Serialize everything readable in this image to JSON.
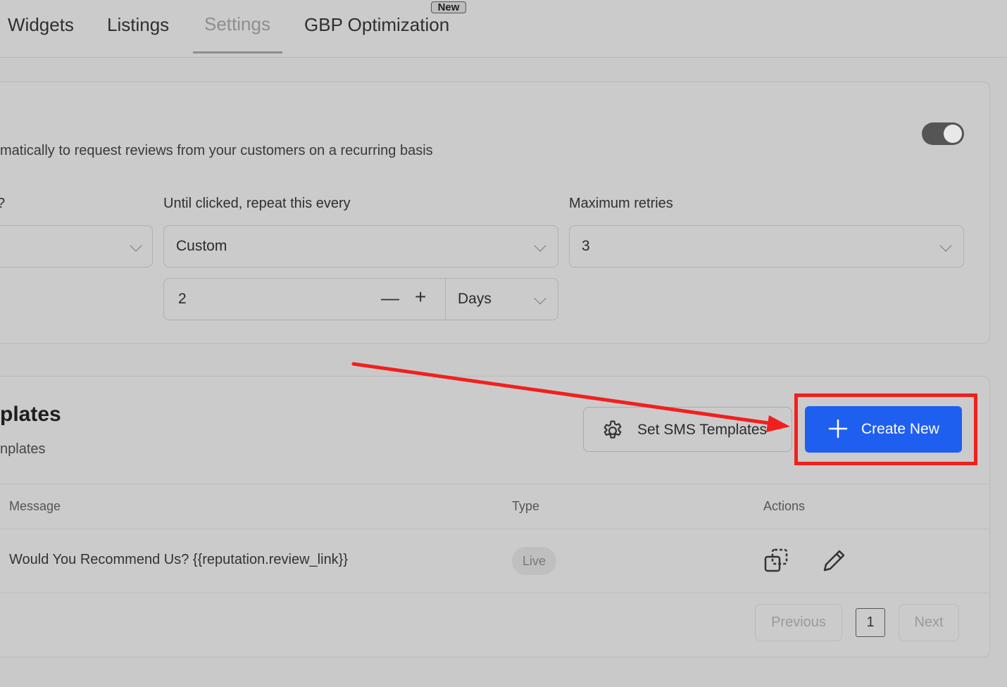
{
  "nav": {
    "tabs": [
      {
        "label": "Widgets"
      },
      {
        "label": "Listings"
      },
      {
        "label": "Settings"
      },
      {
        "label": "GBP Optimization"
      }
    ],
    "new_badge": "New"
  },
  "automation": {
    "description": "matically to request reviews from your customers on a recurring basis",
    "toggle_on": true,
    "first_label": "?",
    "repeat_label": "Until clicked, repeat this every",
    "repeat_value": "Custom",
    "max_retries_label": "Maximum retries",
    "max_retries_value": "3",
    "interval_value": "2",
    "interval_unit": "Days"
  },
  "templates": {
    "title": "plates",
    "subtitle": "nplates",
    "set_sms_label": "Set SMS Templates",
    "create_label": "Create New",
    "columns": [
      "Message",
      "Type",
      "Actions"
    ],
    "rows": [
      {
        "message": "Would You Recommend Us? {{reputation.review_link}}",
        "type": "Live"
      }
    ],
    "pagination": {
      "previous": "Previous",
      "page": "1",
      "next": "Next"
    }
  },
  "colors": {
    "primary": "#1f5ff0",
    "highlight": "#f1201d"
  }
}
